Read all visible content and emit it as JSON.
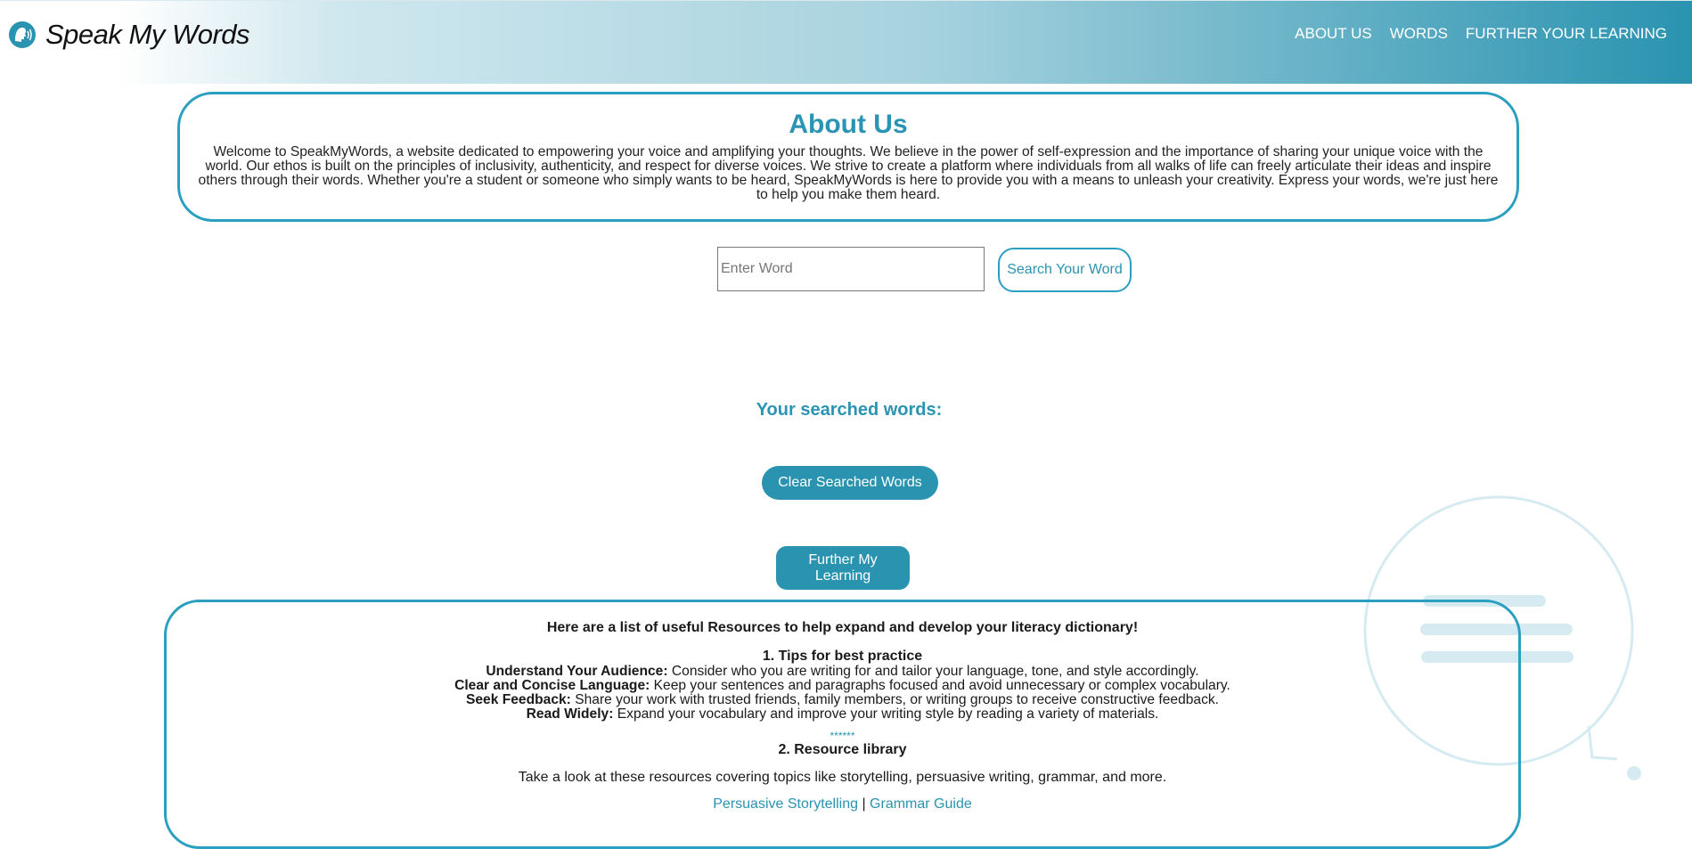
{
  "header": {
    "logo_text": "Speak My Words",
    "nav": [
      "ABOUT US",
      "WORDS",
      "FURTHER YOUR LEARNING"
    ]
  },
  "about": {
    "title": "About Us",
    "body": "Welcome to SpeakMyWords, a website dedicated to empowering your voice and amplifying your thoughts. We believe in the power of self-expression and the importance of sharing your unique voice with the world. Our ethos is built on the principles of inclusivity, authenticity, and respect for diverse voices. We strive to create a platform where individuals from all walks of life can freely articulate their ideas and inspire others through their words. Whether you're a student or someone who simply wants to be heard, SpeakMyWords is here to provide you with a means to unleash your creativity. Express your words, we're just here to help you make them heard."
  },
  "search": {
    "placeholder": "Enter Word",
    "button_label": "Search Your Word"
  },
  "searched": {
    "title": "Your searched words:",
    "clear_label": "Clear Searched Words"
  },
  "further_button_label": "Further My Learning",
  "resources": {
    "intro": "Here are a list of useful Resources to help expand and develop your literacy dictionary!",
    "tips_title": "1. Tips for best practice",
    "tips": [
      {
        "label": "Understand Your Audience:",
        "text": " Consider who you are writing for and tailor your language, tone, and style accordingly."
      },
      {
        "label": "Clear and Concise Language:",
        "text": " Keep your sentences and paragraphs focused and avoid unnecessary or complex vocabulary."
      },
      {
        "label": "Seek Feedback:",
        "text": " Share your work with trusted friends, family members, or writing groups to receive constructive feedback."
      },
      {
        "label": "Read Widely:",
        "text": " Expand your vocabulary and improve your writing style by reading a variety of materials."
      }
    ],
    "separator": "******",
    "library_title": "2. Resource library",
    "library_desc": "Take a look at these resources covering topics like storytelling, persuasive writing, grammar, and more.",
    "links": [
      "Persuasive Storytelling",
      "Grammar Guide"
    ],
    "link_separator": " | "
  },
  "colors": {
    "accent": "#2a93b0",
    "border": "#2a9fc0",
    "bubble": "#d6ebf1"
  },
  "icons": {
    "logo": "speaking-head-icon",
    "decoration": "speech-bubble-icon"
  }
}
